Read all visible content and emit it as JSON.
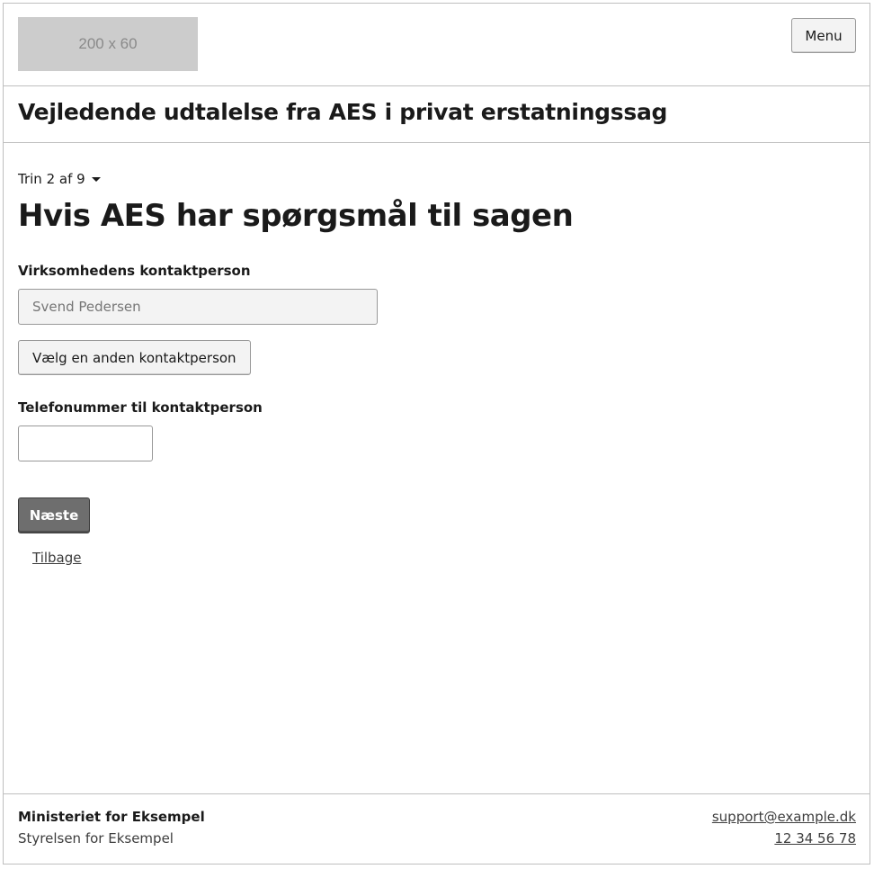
{
  "header": {
    "logo_text": "200 x 60",
    "menu_label": "Menu"
  },
  "app": {
    "title": "Vejledende udtalelse fra AES i privat erstatningssag"
  },
  "main": {
    "step_indicator": "Trin 2 af 9",
    "heading": "Hvis AES har spørgsmål til sagen",
    "contact_person": {
      "label": "Virksomhedens kontaktperson",
      "value": "Svend Pedersen",
      "change_button_label": "Vælg en anden kontaktperson"
    },
    "phone": {
      "label": "Telefonummer til kontaktperson",
      "value": ""
    },
    "next_button_label": "Næste",
    "back_link_label": "Tilbage"
  },
  "footer": {
    "ministry": "Ministeriet for Eksempel",
    "agency": "Styrelsen for Eksempel",
    "email": "support@example.dk",
    "phone": "12 34 56 78"
  },
  "colors": {
    "primary_button": "#6e6e6e",
    "border": "#bfbfbf",
    "logo_placeholder": "#cccccc"
  }
}
